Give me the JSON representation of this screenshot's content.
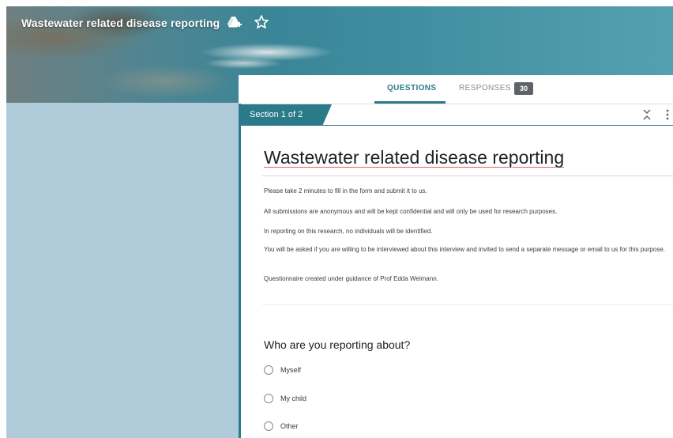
{
  "header": {
    "title": "Wastewater related disease reporting",
    "drive_icon": "drive-add-icon",
    "star_icon": "star-outline-icon"
  },
  "tabs": {
    "questions_label": "QUESTIONS",
    "responses_label": "RESPONSES",
    "responses_count": "30"
  },
  "section": {
    "label": "Section 1 of 2",
    "accent_color": "#2a7a89"
  },
  "form": {
    "title": "Wastewater related disease reporting",
    "description": [
      "Please take 2 minutes to fill in the form and submit it to us.",
      "All submissions are anonymous and will be kept confidential and will only be used for research purposes.",
      "In reporting on this research, no individuals will be identified.",
      "You will be asked if you are willing to be interviewed about this interview and invited to send a separate message or email to us for this purpose.",
      "Questionnaire created under guidance of Prof Edda Weimann."
    ]
  },
  "question": {
    "title": "Who are you reporting about?",
    "options": [
      "Myself",
      "My child",
      "Other"
    ]
  }
}
